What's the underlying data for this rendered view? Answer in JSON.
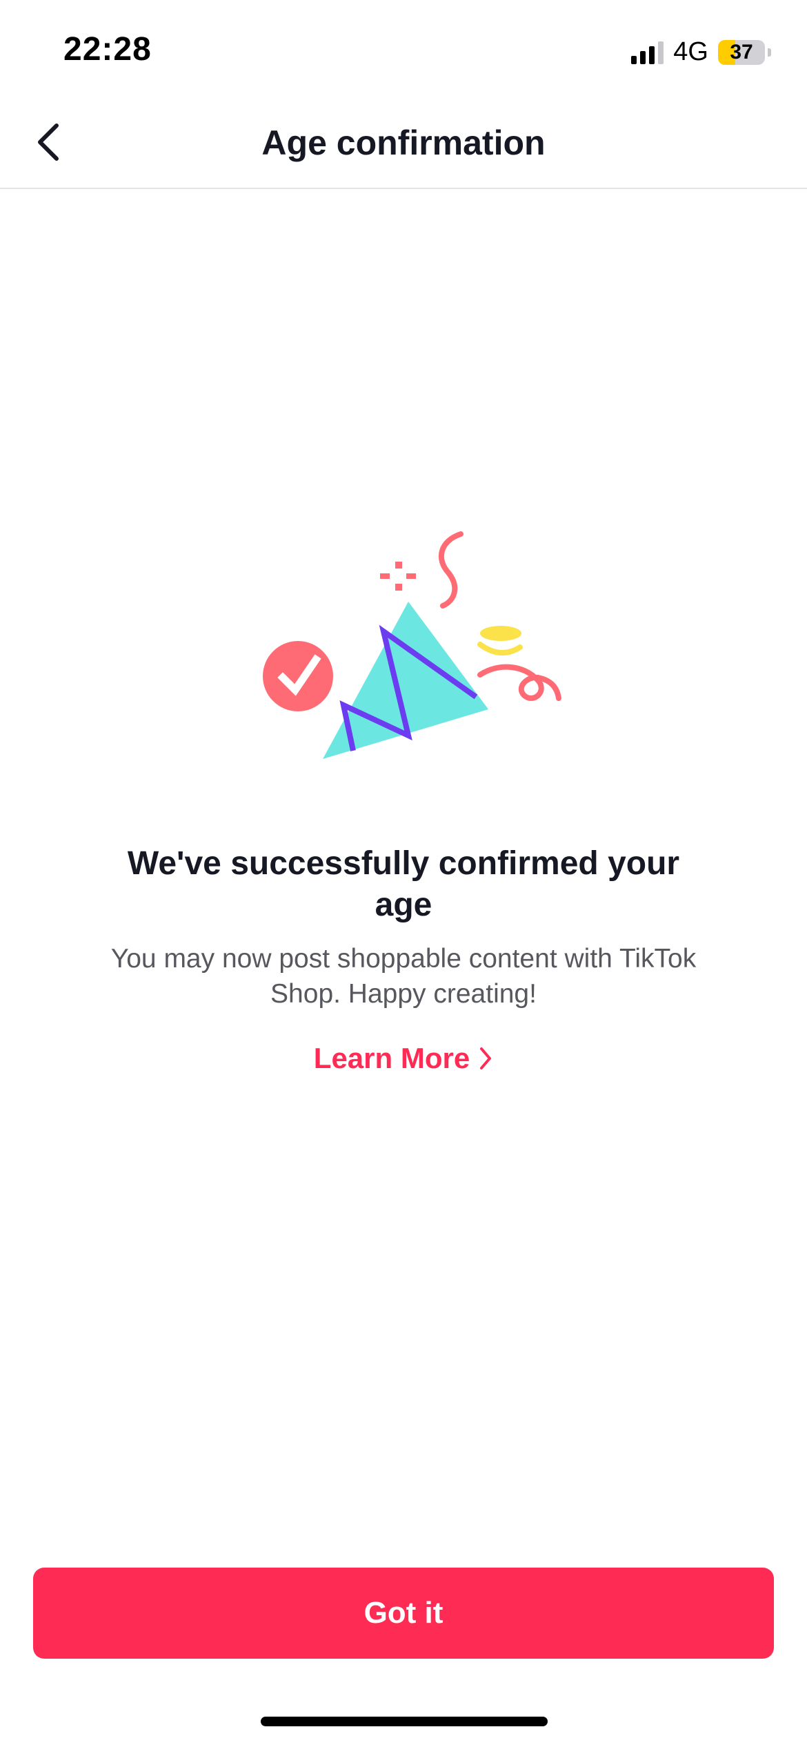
{
  "status_bar": {
    "time": "22:28",
    "network": "4G",
    "battery_level": "37",
    "battery_fraction": 0.37,
    "battery_color": "#ffcc00"
  },
  "nav": {
    "title": "Age confirmation",
    "back_icon": "chevron-left-icon"
  },
  "illustration": {
    "icon": "celebration-confetti-icon",
    "colors": {
      "check_circle": "#fe6b74",
      "triangle": "#6be6e1",
      "zigzag": "#6c3cf0",
      "coin": "#fbe24a",
      "confetti": "#fe6b74"
    }
  },
  "content": {
    "headline": "We've successfully confirmed your age",
    "body": "You may now post shoppable content with TikTok Shop. Happy creating!",
    "learn_more_label": "Learn More",
    "learn_more_icon": "chevron-right-icon"
  },
  "footer": {
    "primary_button_label": "Got it"
  },
  "theme": {
    "accent": "#fe2c55",
    "text_primary": "#161823",
    "text_secondary": "#57585e"
  }
}
